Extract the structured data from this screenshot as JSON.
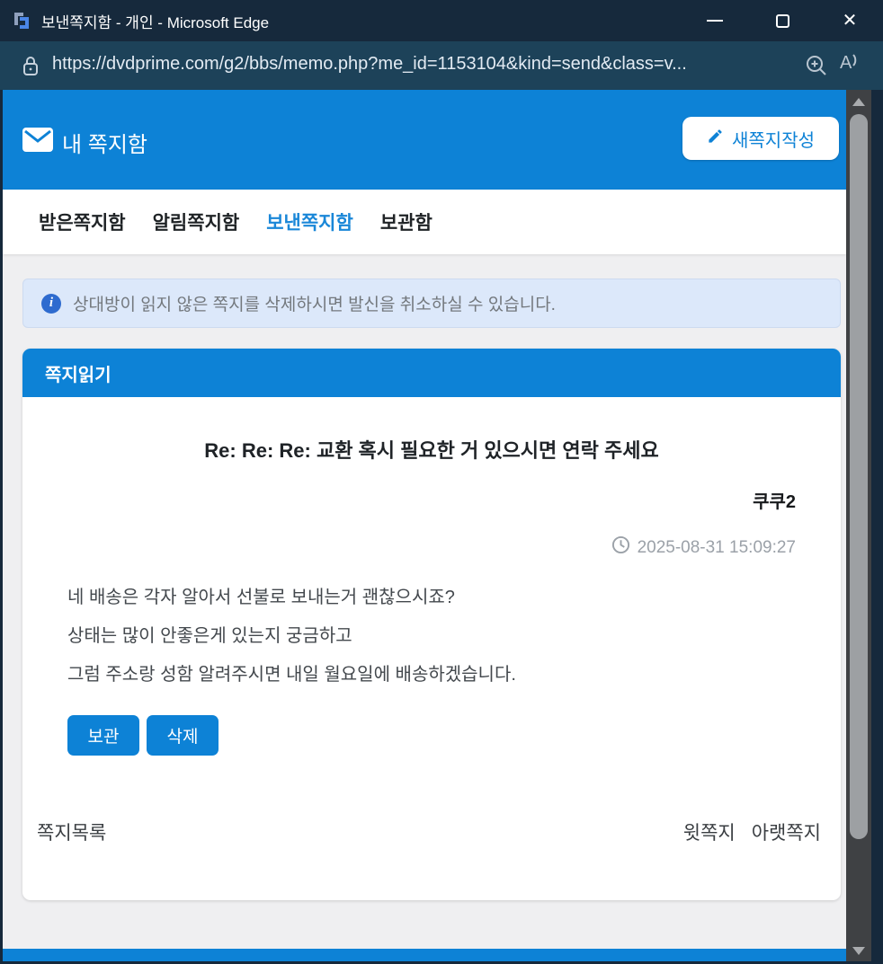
{
  "window": {
    "title": "보낸쪽지함 - 개인 - Microsoft Edge"
  },
  "address_bar": {
    "url": "https://dvdprime.com/g2/bbs/memo.php?me_id=1153104&kind=send&class=v..."
  },
  "mailbox_header": {
    "title": "내 쪽지함",
    "compose_button": "새쪽지작성"
  },
  "tabs": [
    {
      "label": "받은쪽지함",
      "active": false
    },
    {
      "label": "알림쪽지함",
      "active": false
    },
    {
      "label": "보낸쪽지함",
      "active": true
    },
    {
      "label": "보관함",
      "active": false
    }
  ],
  "notice": {
    "text": "상대방이 읽지 않은 쪽지를 삭제하시면 발신을 취소하실 수 있습니다."
  },
  "message_panel": {
    "header": "쪽지읽기",
    "subject": "Re: Re: Re: 교환 혹시 필요한 거 있으시면 연락 주세요",
    "sender": "쿠쿠2",
    "sent_at": "2025-08-31 15:09:27",
    "body_lines": [
      "네 배송은 각자 알아서 선불로 보내는거 괜찮으시죠?",
      "상태는 많이 안좋은게 있는지 궁금하고",
      "그럼 주소랑 성함 알려주시면 내일 월요일에 배송하겠습니다."
    ],
    "buttons": {
      "archive": "보관",
      "delete": "삭제"
    }
  },
  "footer_nav": {
    "list": "쪽지목록",
    "prev": "윗쪽지",
    "next": "아랫쪽지"
  },
  "colors": {
    "titlebar": "#16293c",
    "urlbar": "#1d4259",
    "primary_blue": "#0d82d6",
    "active_tab": "#1a87d8",
    "notice_bg": "#dce8fa",
    "page_bg": "#efeff1"
  }
}
